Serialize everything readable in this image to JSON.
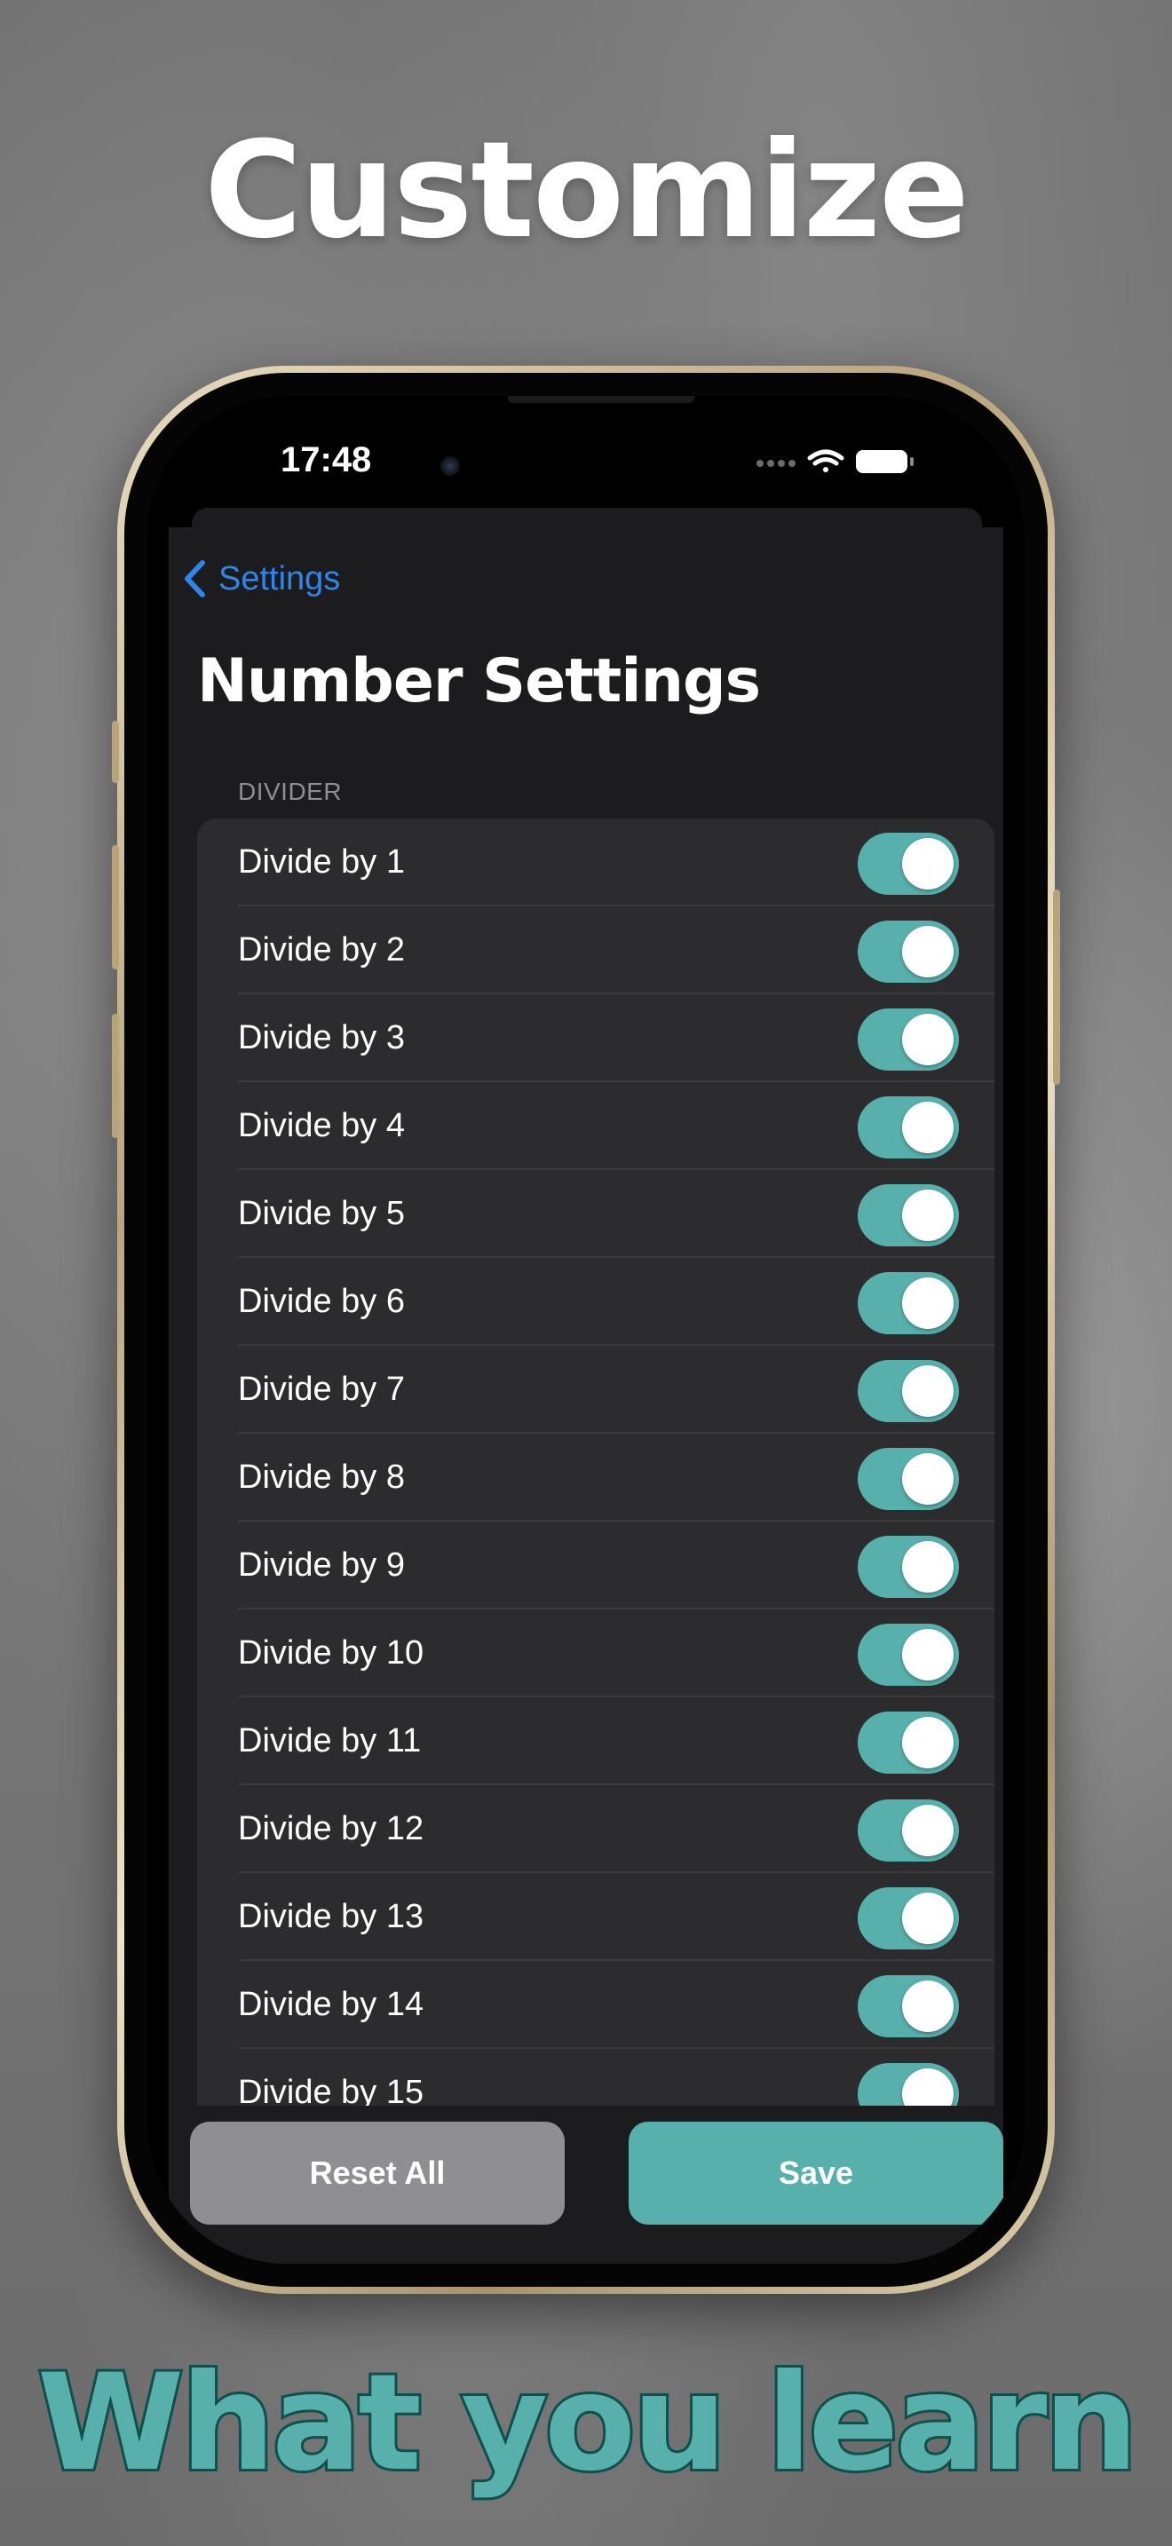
{
  "promo": {
    "headline": "Customize",
    "tagline": "What you learn"
  },
  "status_bar": {
    "time": "17:48"
  },
  "nav": {
    "back_label": "Settings"
  },
  "page": {
    "title": "Number Settings"
  },
  "section": {
    "header": "DIVIDER",
    "rows": [
      {
        "label": "Divide by 1",
        "on": true
      },
      {
        "label": "Divide by 2",
        "on": true
      },
      {
        "label": "Divide by 3",
        "on": true
      },
      {
        "label": "Divide by 4",
        "on": true
      },
      {
        "label": "Divide by 5",
        "on": true
      },
      {
        "label": "Divide by 6",
        "on": true
      },
      {
        "label": "Divide by 7",
        "on": true
      },
      {
        "label": "Divide by 8",
        "on": true
      },
      {
        "label": "Divide by 9",
        "on": true
      },
      {
        "label": "Divide by 10",
        "on": true
      },
      {
        "label": "Divide by 11",
        "on": true
      },
      {
        "label": "Divide by 12",
        "on": true
      },
      {
        "label": "Divide by 13",
        "on": true
      },
      {
        "label": "Divide by 14",
        "on": true
      },
      {
        "label": "Divide by 15",
        "on": true
      }
    ]
  },
  "actions": {
    "reset_label": "Reset All",
    "save_label": "Save"
  },
  "colors": {
    "accent": "#58b0ac",
    "link": "#2f86e8",
    "background": "#1c1c1e",
    "cell": "#2c2c2e",
    "secondary_button": "#8e8e93"
  }
}
